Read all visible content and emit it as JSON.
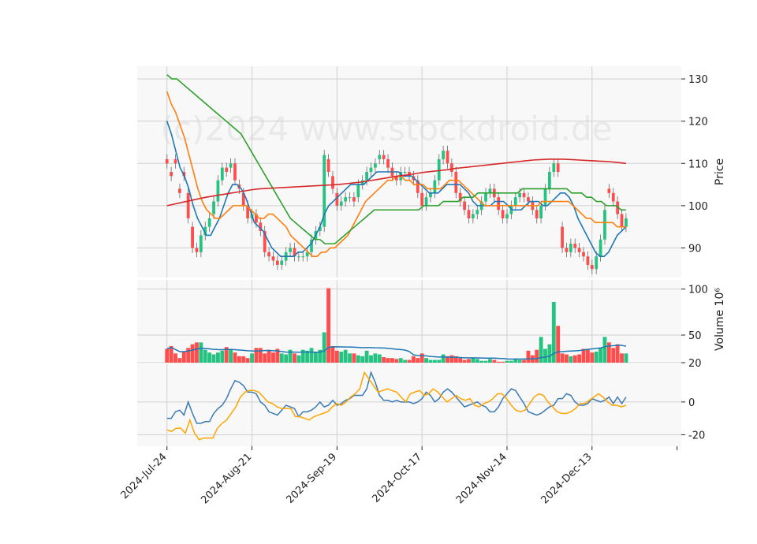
{
  "watermark": "(c)2024 www.stockdroid.de",
  "colors": {
    "panel_bg": "#f8f8f8",
    "grid": "#d0d0d0",
    "up": "#26c281",
    "down": "#ff4d4d",
    "ma_blue": "#1f77b4",
    "ma_orange": "#ff7f0e",
    "ma_green": "#2ca02c",
    "ma_red": "#d62728",
    "osc_blue": "#3a7ab5",
    "osc_orange": "#ffa500",
    "vol_avg": "#1f77b4"
  },
  "chart_data": [
    {
      "type": "candlestick",
      "ylabel": "Price",
      "ylim": [
        83,
        133
      ],
      "yticks": [
        90,
        100,
        110,
        120,
        130
      ],
      "x_tick_labels": [
        "2024-Jul-24",
        "2024-Aug-21",
        "2024-Sep-19",
        "2024-Oct-17",
        "2024-Nov-14",
        "2024-Dec-13"
      ],
      "x_tick_index": [
        0,
        20,
        40,
        60,
        80,
        100
      ],
      "xlim": [
        -7,
        121
      ],
      "close": [
        110,
        107,
        110,
        103,
        107,
        97,
        90,
        89,
        93,
        95,
        97,
        101,
        106,
        109,
        108,
        110,
        106,
        104,
        100,
        97,
        98,
        96,
        94,
        89,
        88,
        87,
        86,
        87,
        89,
        90,
        88,
        88,
        88,
        89,
        92,
        94,
        95,
        112,
        108,
        104,
        100,
        101,
        102,
        102,
        101,
        105,
        106,
        108,
        109,
        110,
        112,
        111,
        109,
        107,
        106,
        108,
        108,
        107,
        106,
        103,
        100,
        102,
        103,
        106,
        111,
        113,
        110,
        108,
        103,
        101,
        99,
        97,
        98,
        99,
        101,
        103,
        104,
        102,
        99,
        97,
        98,
        100,
        102,
        103,
        102,
        101,
        99,
        97,
        100,
        104,
        108,
        110,
        108,
        90,
        89,
        91,
        90,
        89,
        88,
        86,
        85,
        88,
        92,
        99,
        103,
        101,
        98,
        95,
        97
      ],
      "open": [
        111,
        108,
        111,
        104,
        108,
        103,
        95,
        90,
        89,
        93,
        95,
        98,
        101,
        106,
        109,
        109,
        110,
        105,
        103,
        100,
        97,
        98,
        96,
        94,
        89,
        88,
        87,
        86,
        87,
        89,
        90,
        88,
        88,
        88,
        89,
        92,
        94,
        95,
        111,
        107,
        103,
        100,
        101,
        102,
        102,
        102,
        105,
        106,
        108,
        109,
        111,
        112,
        111,
        109,
        107,
        106,
        108,
        108,
        107,
        106,
        103,
        100,
        102,
        103,
        106,
        111,
        113,
        110,
        108,
        103,
        101,
        99,
        97,
        98,
        99,
        101,
        103,
        104,
        102,
        99,
        97,
        98,
        100,
        102,
        103,
        102,
        101,
        99,
        97,
        100,
        104,
        108,
        110,
        95,
        90,
        89,
        91,
        90,
        89,
        88,
        86,
        85,
        88,
        92,
        104,
        103,
        101,
        98,
        95
      ],
      "volume": [
        35,
        38,
        30,
        25,
        32,
        36,
        40,
        42,
        42,
        34,
        31,
        29,
        31,
        33,
        37,
        34,
        31,
        27,
        27,
        25,
        30,
        36,
        36,
        30,
        34,
        31,
        35,
        30,
        29,
        34,
        30,
        28,
        34,
        33,
        36,
        31,
        34,
        53,
        101,
        38,
        33,
        32,
        34,
        30,
        30,
        28,
        27,
        33,
        28,
        30,
        29,
        26,
        25,
        25,
        24,
        25,
        23,
        23,
        27,
        25,
        30,
        25,
        23,
        23,
        23,
        29,
        27,
        28,
        27,
        25,
        23,
        24,
        25,
        24,
        22,
        22,
        24,
        23,
        21,
        21,
        22,
        22,
        24,
        23,
        23,
        33,
        28,
        34,
        48,
        35,
        40,
        86,
        60,
        30,
        29,
        27,
        28,
        29,
        35,
        34,
        31,
        32,
        36,
        48,
        42,
        36,
        40,
        30,
        30
      ],
      "volume_ylabel": "Volume  10⁶",
      "volume_ylim": [
        20,
        110
      ],
      "volume_yticks": [
        20,
        50,
        100
      ],
      "oscillator_ylim": [
        -27,
        23
      ],
      "oscillator_yticks": [
        -20,
        0
      ],
      "series": [
        {
          "values": [
            120,
            117,
            113,
            109,
            107,
            104,
            100,
            97,
            95,
            93,
            93,
            95,
            97,
            100,
            103,
            105,
            105,
            104,
            102,
            99,
            96,
            95,
            94,
            92,
            90,
            89,
            88,
            88,
            88,
            88,
            89,
            89,
            90,
            91,
            93,
            95,
            98,
            100,
            101,
            102,
            103,
            104,
            105,
            105,
            105,
            105,
            106,
            107,
            108,
            108,
            108,
            108,
            108,
            108,
            107,
            107,
            107,
            106,
            105,
            104,
            103,
            103,
            103,
            104,
            105,
            105,
            105,
            105,
            104,
            103,
            101,
            100,
            100,
            100,
            100,
            101,
            101,
            101,
            100,
            99,
            99,
            99,
            100,
            101,
            101,
            101,
            100,
            100,
            101,
            102,
            103,
            103,
            102,
            100,
            97,
            95,
            93,
            91,
            89,
            88,
            88,
            89,
            91,
            93,
            94,
            95
          ]
        },
        {
          "values": [
            127,
            124,
            122,
            119,
            116,
            112,
            108,
            104,
            101,
            99,
            98,
            97,
            97,
            98,
            99,
            100,
            100,
            100,
            100,
            99,
            98,
            97,
            97,
            98,
            98,
            97,
            96,
            95,
            93,
            92,
            91,
            90,
            89,
            88,
            88,
            89,
            89,
            90,
            90,
            91,
            92,
            93,
            95,
            97,
            99,
            101,
            102,
            103,
            104,
            105,
            106,
            106,
            107,
            107,
            106,
            106,
            105,
            105,
            105,
            104,
            104,
            104,
            104,
            105,
            106,
            106,
            106,
            105,
            104,
            103,
            102,
            101,
            100,
            100,
            100,
            100,
            100,
            100,
            100,
            100,
            100,
            100,
            100,
            100,
            100,
            101,
            101,
            101,
            101,
            101,
            101,
            101,
            100,
            99,
            98,
            97,
            97,
            96,
            96,
            96,
            96,
            96,
            95,
            95,
            95
          ]
        },
        {
          "values": [
            131,
            130,
            130,
            129,
            128,
            127,
            126,
            125,
            124,
            123,
            122,
            121,
            120,
            119,
            118,
            117,
            115,
            113,
            111,
            109,
            107,
            105,
            103,
            101,
            99,
            97,
            96,
            95,
            94,
            93,
            92,
            92,
            91,
            91,
            91,
            92,
            93,
            94,
            95,
            96,
            97,
            98,
            99,
            99,
            99,
            99,
            99,
            99,
            99,
            99,
            99,
            99,
            100,
            100,
            100,
            100,
            101,
            101,
            101,
            101,
            102,
            102,
            102,
            103,
            103,
            103,
            103,
            103,
            103,
            103,
            103,
            103,
            104,
            104,
            104,
            104,
            104,
            104,
            104,
            104,
            104,
            104,
            103,
            103,
            103,
            102,
            102,
            101,
            101,
            100,
            100,
            100,
            99,
            99
          ]
        },
        {
          "values": [
            100,
            100.4,
            100.8,
            101.2,
            101.6,
            102,
            102.3,
            102.6,
            102.9,
            103.2,
            103.5,
            103.8,
            104,
            104.1,
            104.2,
            104.3,
            104.4,
            104.5,
            104.6,
            104.7,
            104.8,
            104.9,
            105,
            105.2,
            105.4,
            105.6,
            105.9,
            106.2,
            106.5,
            106.8,
            107.1,
            107.3,
            107.6,
            107.9,
            108.1,
            108.3,
            108.5,
            108.8,
            109,
            109.2,
            109.4,
            109.6,
            109.8,
            110,
            110.2,
            110.4,
            110.6,
            110.8,
            110.9,
            111,
            111,
            111,
            110.9,
            110.8,
            110.7,
            110.6,
            110.5,
            110.4,
            110.2,
            110
          ]
        },
        {
          "values": [
            -10,
            -10,
            -6,
            -5,
            -8,
            0,
            -7,
            -13,
            -13,
            -12,
            -12,
            -7,
            -4,
            -2,
            2,
            8,
            13,
            12,
            10,
            6,
            6,
            5,
            0,
            -2,
            -6,
            -7,
            -8,
            -5,
            -2,
            -3,
            -4,
            -9,
            -6,
            -6,
            -5,
            -3,
            0,
            -3,
            -2,
            1,
            -2,
            -1,
            1,
            2,
            4,
            4,
            4,
            8,
            18,
            12,
            4,
            1,
            1,
            0,
            1,
            0,
            0,
            0,
            -1,
            0,
            2,
            6,
            4,
            0,
            2,
            6,
            8,
            6,
            3,
            0,
            -3,
            -2,
            -1,
            0,
            -2,
            -3,
            -6,
            -6,
            -3,
            2,
            5,
            8,
            7,
            3,
            -1,
            -6,
            -7,
            -8,
            -7,
            -5,
            -3,
            -2,
            2,
            2,
            5,
            4,
            0,
            -2,
            -2,
            -1,
            2,
            1,
            0,
            1,
            3,
            -1,
            3,
            -1,
            3
          ]
        },
        {
          "values": [
            -17,
            -18,
            -16,
            -16,
            -19,
            -11,
            -19,
            -23,
            -22,
            -22,
            -22,
            -16,
            -13,
            -11,
            -7,
            -3,
            3,
            6,
            7,
            7,
            6,
            3,
            0,
            -1,
            -3,
            -4,
            -4,
            -4,
            -9,
            -9,
            -10,
            -11,
            -9,
            -8,
            -7,
            -6,
            -3,
            -1,
            -2,
            0,
            3,
            5,
            8,
            18,
            14,
            10,
            6,
            7,
            8,
            7,
            6,
            3,
            0,
            5,
            6,
            7,
            4,
            5,
            8,
            6,
            3,
            0,
            2,
            4,
            2,
            1,
            2,
            -2,
            -3,
            -1,
            0,
            2,
            5,
            5,
            2,
            -2,
            -5,
            -6,
            -5,
            -1,
            3,
            5,
            4,
            0,
            -3,
            -6,
            -7,
            -7,
            -6,
            -4,
            -1,
            -1,
            1,
            3,
            5,
            3,
            0,
            -2,
            -2,
            -3,
            -2
          ]
        }
      ]
    }
  ]
}
